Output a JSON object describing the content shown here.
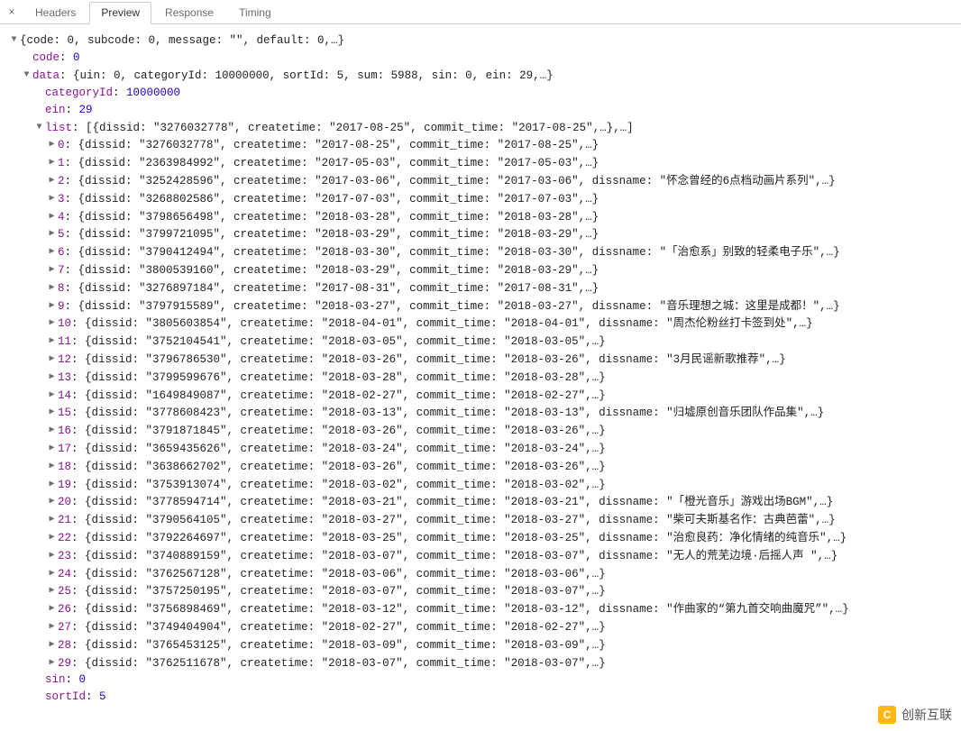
{
  "tabs": {
    "close": "×",
    "items": [
      {
        "label": "Headers",
        "active": false
      },
      {
        "label": "Preview",
        "active": true
      },
      {
        "label": "Response",
        "active": false
      },
      {
        "label": "Timing",
        "active": false
      }
    ]
  },
  "root_summary": "{code: 0, subcode: 0, message: \"\", default: 0,…}",
  "code_key": "code",
  "code_val": "0",
  "data_key": "data",
  "data_summary": "{uin: 0, categoryId: 10000000, sortId: 5, sum: 5988, sin: 0, ein: 29,…}",
  "categoryId_key": "categoryId",
  "categoryId_val": "10000000",
  "ein_key": "ein",
  "ein_val": "29",
  "list_key": "list",
  "list_summary": "[{dissid: \"3276032778\", createtime: \"2017-08-25\", commit_time: \"2017-08-25\",…},…]",
  "list": [
    {
      "idx": "0",
      "dissid": "3276032778",
      "createtime": "2017-08-25",
      "commit_time": "2017-08-25"
    },
    {
      "idx": "1",
      "dissid": "2363984992",
      "createtime": "2017-05-03",
      "commit_time": "2017-05-03"
    },
    {
      "idx": "2",
      "dissid": "3252428596",
      "createtime": "2017-03-06",
      "commit_time": "2017-03-06",
      "dissname": "怀念曾经的6点档动画片系列"
    },
    {
      "idx": "3",
      "dissid": "3268802586",
      "createtime": "2017-07-03",
      "commit_time": "2017-07-03"
    },
    {
      "idx": "4",
      "dissid": "3798656498",
      "createtime": "2018-03-28",
      "commit_time": "2018-03-28"
    },
    {
      "idx": "5",
      "dissid": "3799721095",
      "createtime": "2018-03-29",
      "commit_time": "2018-03-29"
    },
    {
      "idx": "6",
      "dissid": "3790412494",
      "createtime": "2018-03-30",
      "commit_time": "2018-03-30",
      "dissname": "「治愈系」别致的轻柔电子乐"
    },
    {
      "idx": "7",
      "dissid": "3800539160",
      "createtime": "2018-03-29",
      "commit_time": "2018-03-29"
    },
    {
      "idx": "8",
      "dissid": "3276897184",
      "createtime": "2017-08-31",
      "commit_time": "2017-08-31"
    },
    {
      "idx": "9",
      "dissid": "3797915589",
      "createtime": "2018-03-27",
      "commit_time": "2018-03-27",
      "dissname": "音乐理想之城：这里是成都！"
    },
    {
      "idx": "10",
      "dissid": "3805603854",
      "createtime": "2018-04-01",
      "commit_time": "2018-04-01",
      "dissname": "周杰伦粉丝打卡签到处"
    },
    {
      "idx": "11",
      "dissid": "3752104541",
      "createtime": "2018-03-05",
      "commit_time": "2018-03-05"
    },
    {
      "idx": "12",
      "dissid": "3796786530",
      "createtime": "2018-03-26",
      "commit_time": "2018-03-26",
      "dissname": "3月民谣新歌推荐"
    },
    {
      "idx": "13",
      "dissid": "3799599676",
      "createtime": "2018-03-28",
      "commit_time": "2018-03-28"
    },
    {
      "idx": "14",
      "dissid": "1649849087",
      "createtime": "2018-02-27",
      "commit_time": "2018-02-27"
    },
    {
      "idx": "15",
      "dissid": "3778608423",
      "createtime": "2018-03-13",
      "commit_time": "2018-03-13",
      "dissname": "归墟原创音乐团队作品集"
    },
    {
      "idx": "16",
      "dissid": "3791871845",
      "createtime": "2018-03-26",
      "commit_time": "2018-03-26"
    },
    {
      "idx": "17",
      "dissid": "3659435626",
      "createtime": "2018-03-24",
      "commit_time": "2018-03-24"
    },
    {
      "idx": "18",
      "dissid": "3638662702",
      "createtime": "2018-03-26",
      "commit_time": "2018-03-26"
    },
    {
      "idx": "19",
      "dissid": "3753913074",
      "createtime": "2018-03-02",
      "commit_time": "2018-03-02"
    },
    {
      "idx": "20",
      "dissid": "3778594714",
      "createtime": "2018-03-21",
      "commit_time": "2018-03-21",
      "dissname": "「橙光音乐」游戏出场BGM"
    },
    {
      "idx": "21",
      "dissid": "3790564105",
      "createtime": "2018-03-27",
      "commit_time": "2018-03-27",
      "dissname": "柴可夫斯基名作：古典芭蕾"
    },
    {
      "idx": "22",
      "dissid": "3792264697",
      "createtime": "2018-03-25",
      "commit_time": "2018-03-25",
      "dissname": "治愈良药：净化情绪的纯音乐"
    },
    {
      "idx": "23",
      "dissid": "3740889159",
      "createtime": "2018-03-07",
      "commit_time": "2018-03-07",
      "dissname": "无人的荒芜边境·后摇人声 "
    },
    {
      "idx": "24",
      "dissid": "3762567128",
      "createtime": "2018-03-06",
      "commit_time": "2018-03-06"
    },
    {
      "idx": "25",
      "dissid": "3757250195",
      "createtime": "2018-03-07",
      "commit_time": "2018-03-07"
    },
    {
      "idx": "26",
      "dissid": "3756898469",
      "createtime": "2018-03-12",
      "commit_time": "2018-03-12",
      "dissname": "作曲家的“第九首交响曲魔咒”"
    },
    {
      "idx": "27",
      "dissid": "3749404904",
      "createtime": "2018-02-27",
      "commit_time": "2018-02-27"
    },
    {
      "idx": "28",
      "dissid": "3765453125",
      "createtime": "2018-03-09",
      "commit_time": "2018-03-09"
    },
    {
      "idx": "29",
      "dissid": "3762511678",
      "createtime": "2018-03-07",
      "commit_time": "2018-03-07"
    }
  ],
  "sin_key": "sin",
  "sin_val": "0",
  "sortId_key": "sortId",
  "sortId_val": "5",
  "watermark": "创新互联"
}
